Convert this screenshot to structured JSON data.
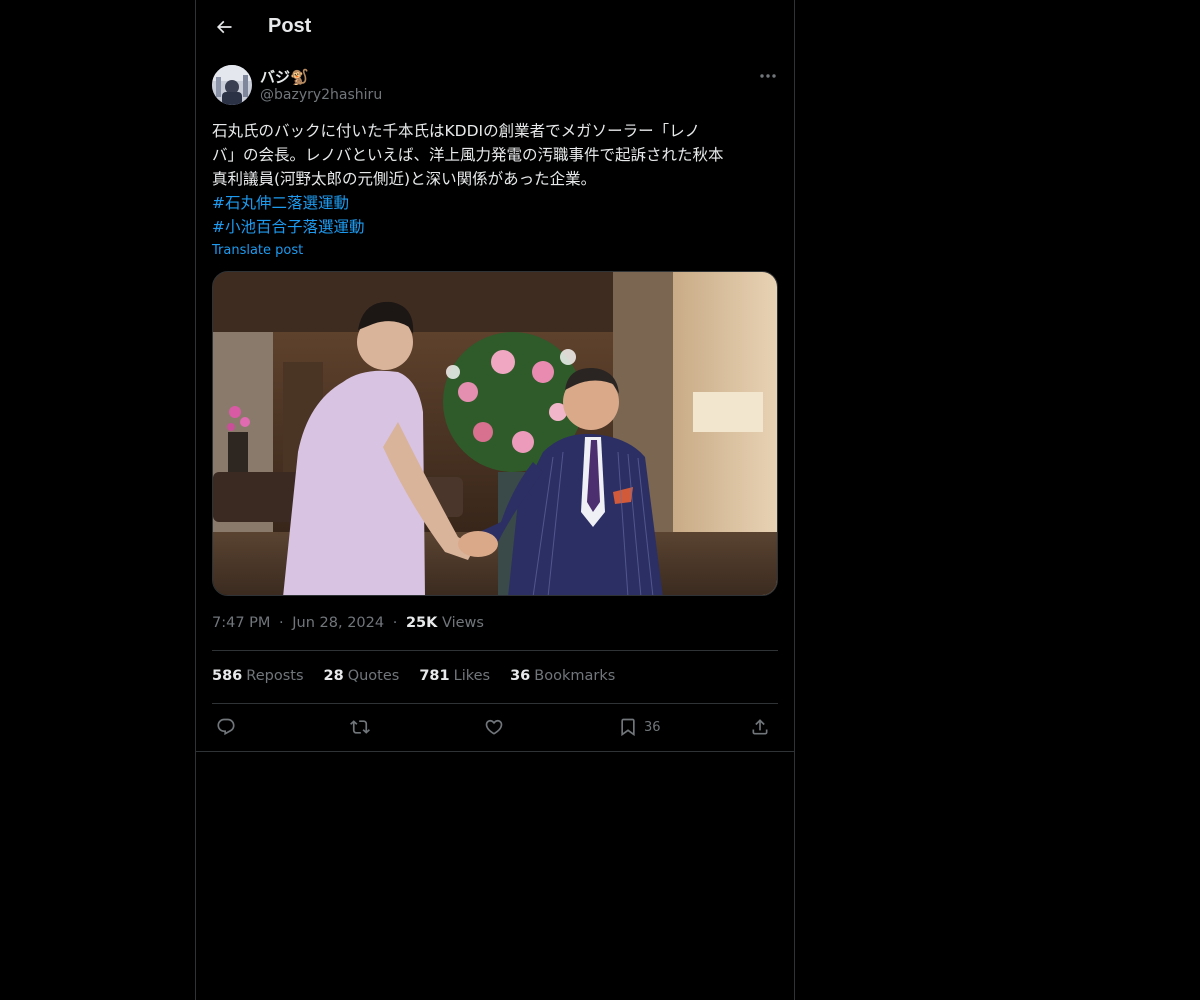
{
  "header": {
    "title": "Post",
    "back_icon": "arrow-left-icon"
  },
  "author": {
    "name": "バジ🐒",
    "handle": "@bazyry2hashiru"
  },
  "post": {
    "text_lines": [
      "石丸氏のバックに付いた千本氏はKDDIの創業者でメガソーラー「レノ",
      "バ」の会長。レノバといえば、洋上風力発電の汚職事件で起訴された秋本",
      "真利議員(河野太郎の元側近)と深い関係があった企業。"
    ],
    "hashtags": [
      "#石丸伸二落選運動",
      "#小池百合子落選運動"
    ],
    "translate_label": "Translate post"
  },
  "meta": {
    "time": "7:47 PM",
    "sep1": "·",
    "date": "Jun 28, 2024",
    "sep2": "·",
    "views_count": "25K",
    "views_label": "Views"
  },
  "stats": {
    "reposts_count": "586",
    "reposts_label": "Reposts",
    "quotes_count": "28",
    "quotes_label": "Quotes",
    "likes_count": "781",
    "likes_label": "Likes",
    "bookmarks_count": "36",
    "bookmarks_label": "Bookmarks"
  },
  "actions": {
    "reply_icon": "reply-icon",
    "repost_icon": "repost-icon",
    "like_icon": "heart-icon",
    "bookmark_icon": "bookmark-icon",
    "bookmark_count": "36",
    "share_icon": "share-icon"
  },
  "colors": {
    "background": "#000000",
    "text": "#e7e9ea",
    "secondary": "#71767b",
    "link": "#1d9bf0",
    "border": "#2f3336"
  }
}
